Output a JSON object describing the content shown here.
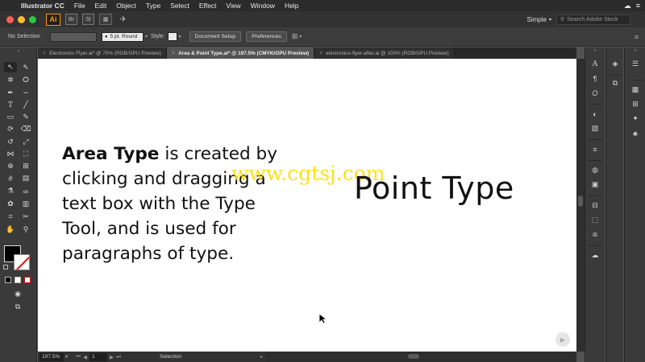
{
  "menubar": {
    "apple": "",
    "app_name": "Illustrator CC",
    "items": [
      "File",
      "Edit",
      "Object",
      "Type",
      "Select",
      "Effect",
      "View",
      "Window",
      "Help"
    ]
  },
  "appbar": {
    "logo": "Ai",
    "bridge": "Br",
    "stock": "St",
    "workspace": "Simple",
    "search_placeholder": "Search Adobe Stock"
  },
  "controlbar": {
    "selection_label": "No Selection",
    "stroke_profile": "5 pt. Round",
    "style_label": "Style:",
    "document_setup": "Document Setup",
    "preferences": "Preferences"
  },
  "tabs": [
    {
      "label": "Electronics Flyer.ai* @ 70% (RGB/GPU Preview)",
      "active": false
    },
    {
      "label": "Area & Point Type.ai* @ 197.5% (CMYK/GPU Preview)",
      "active": true
    },
    {
      "label": "electronics-flyer-after.ai @ 100% (RGB/GPU Preview)",
      "active": false
    }
  ],
  "canvas": {
    "area_bold": "Area Type",
    "area_line1_rest": " is created by",
    "area_line2": "clicking and dragging a",
    "area_line3": "text box with the Type",
    "area_line4": "Tool, and is used for",
    "area_line5": "paragraphs of type.",
    "point_type": "Point Type",
    "watermark": "www.cgtsj.com"
  },
  "statusbar": {
    "zoom": "197.5%",
    "page": "1",
    "tool": "Selection"
  },
  "colors": {
    "menubar_bg": "#2b2b2b",
    "ui_dark": "#3a3a3a",
    "canvas_bg": "#ffffff",
    "watermark": "#ffdd00",
    "ai_accent": "#ff9a00"
  }
}
